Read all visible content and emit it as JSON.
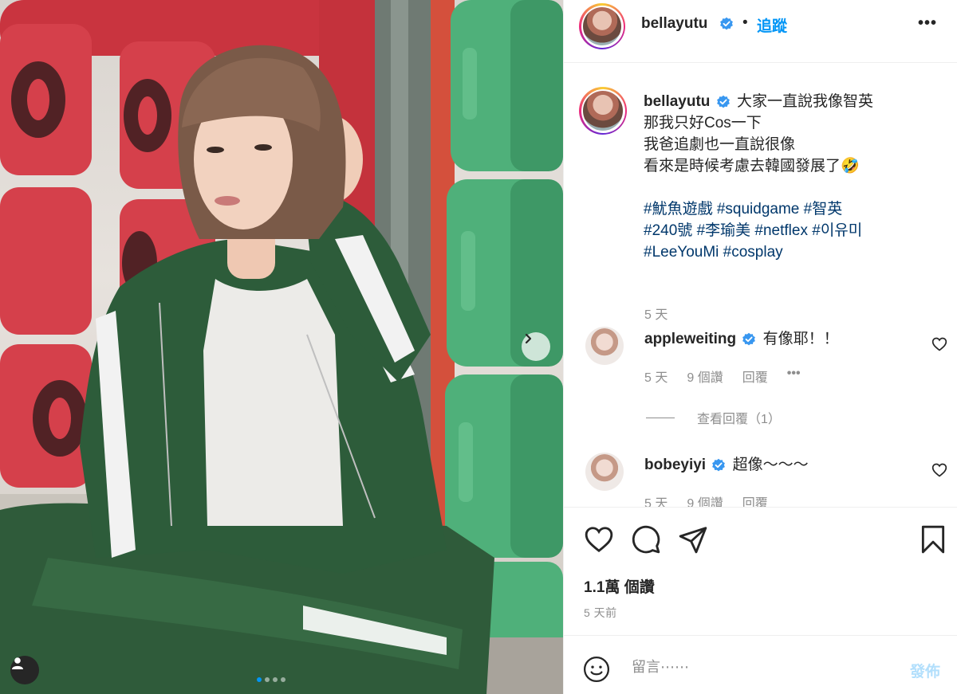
{
  "header": {
    "username": "bellayutu",
    "bullet": "•",
    "follow_label": "追蹤",
    "more_label": "•••"
  },
  "caption": {
    "username": "bellayutu",
    "lines": [
      "大家一直說我像智英",
      "那我只好Cos一下",
      "我爸追劇也一直說很像",
      "看來是時候考慮去韓國發展了🤣"
    ],
    "hashtags": [
      [
        "#魷魚遊戲",
        "#squidgame",
        "#智英"
      ],
      [
        "#240號",
        "#李瑜美",
        "#netflex",
        "#이유미"
      ],
      [
        "#LeeYouMi",
        "#cosplay"
      ]
    ],
    "time": "5 天"
  },
  "comments": [
    {
      "username": "appleweiting",
      "text": "有像耶！！",
      "time": "5 天",
      "likes": "9 個讚",
      "reply_label": "回覆",
      "more_label": "•••"
    },
    {
      "username": "bobeyiyi",
      "text": "超像～～～",
      "time": "5 天",
      "likes": "9 個讚",
      "reply_label": "回覆"
    }
  ],
  "view_replies_label": "查看回覆（1）",
  "likes_count": "1.1萬 個讚",
  "posted_time": "5 天前",
  "add_comment": {
    "placeholder": "留言⋯⋯",
    "post_label": "發佈"
  },
  "carousel": {
    "slide_count": 4,
    "active_index": 0
  },
  "colors": {
    "link_blue": "#0095f6",
    "hashtag": "#00376b",
    "muted": "#8e8e8e",
    "verified": "#3897f0"
  },
  "icons": {
    "like": "heart-icon",
    "comment": "comment-icon",
    "share": "paper-plane-icon",
    "save": "bookmark-icon",
    "next": "chevron-right-icon",
    "tag": "user-tag-icon",
    "emoji": "smiley-icon",
    "verified": "verified-badge-icon"
  }
}
